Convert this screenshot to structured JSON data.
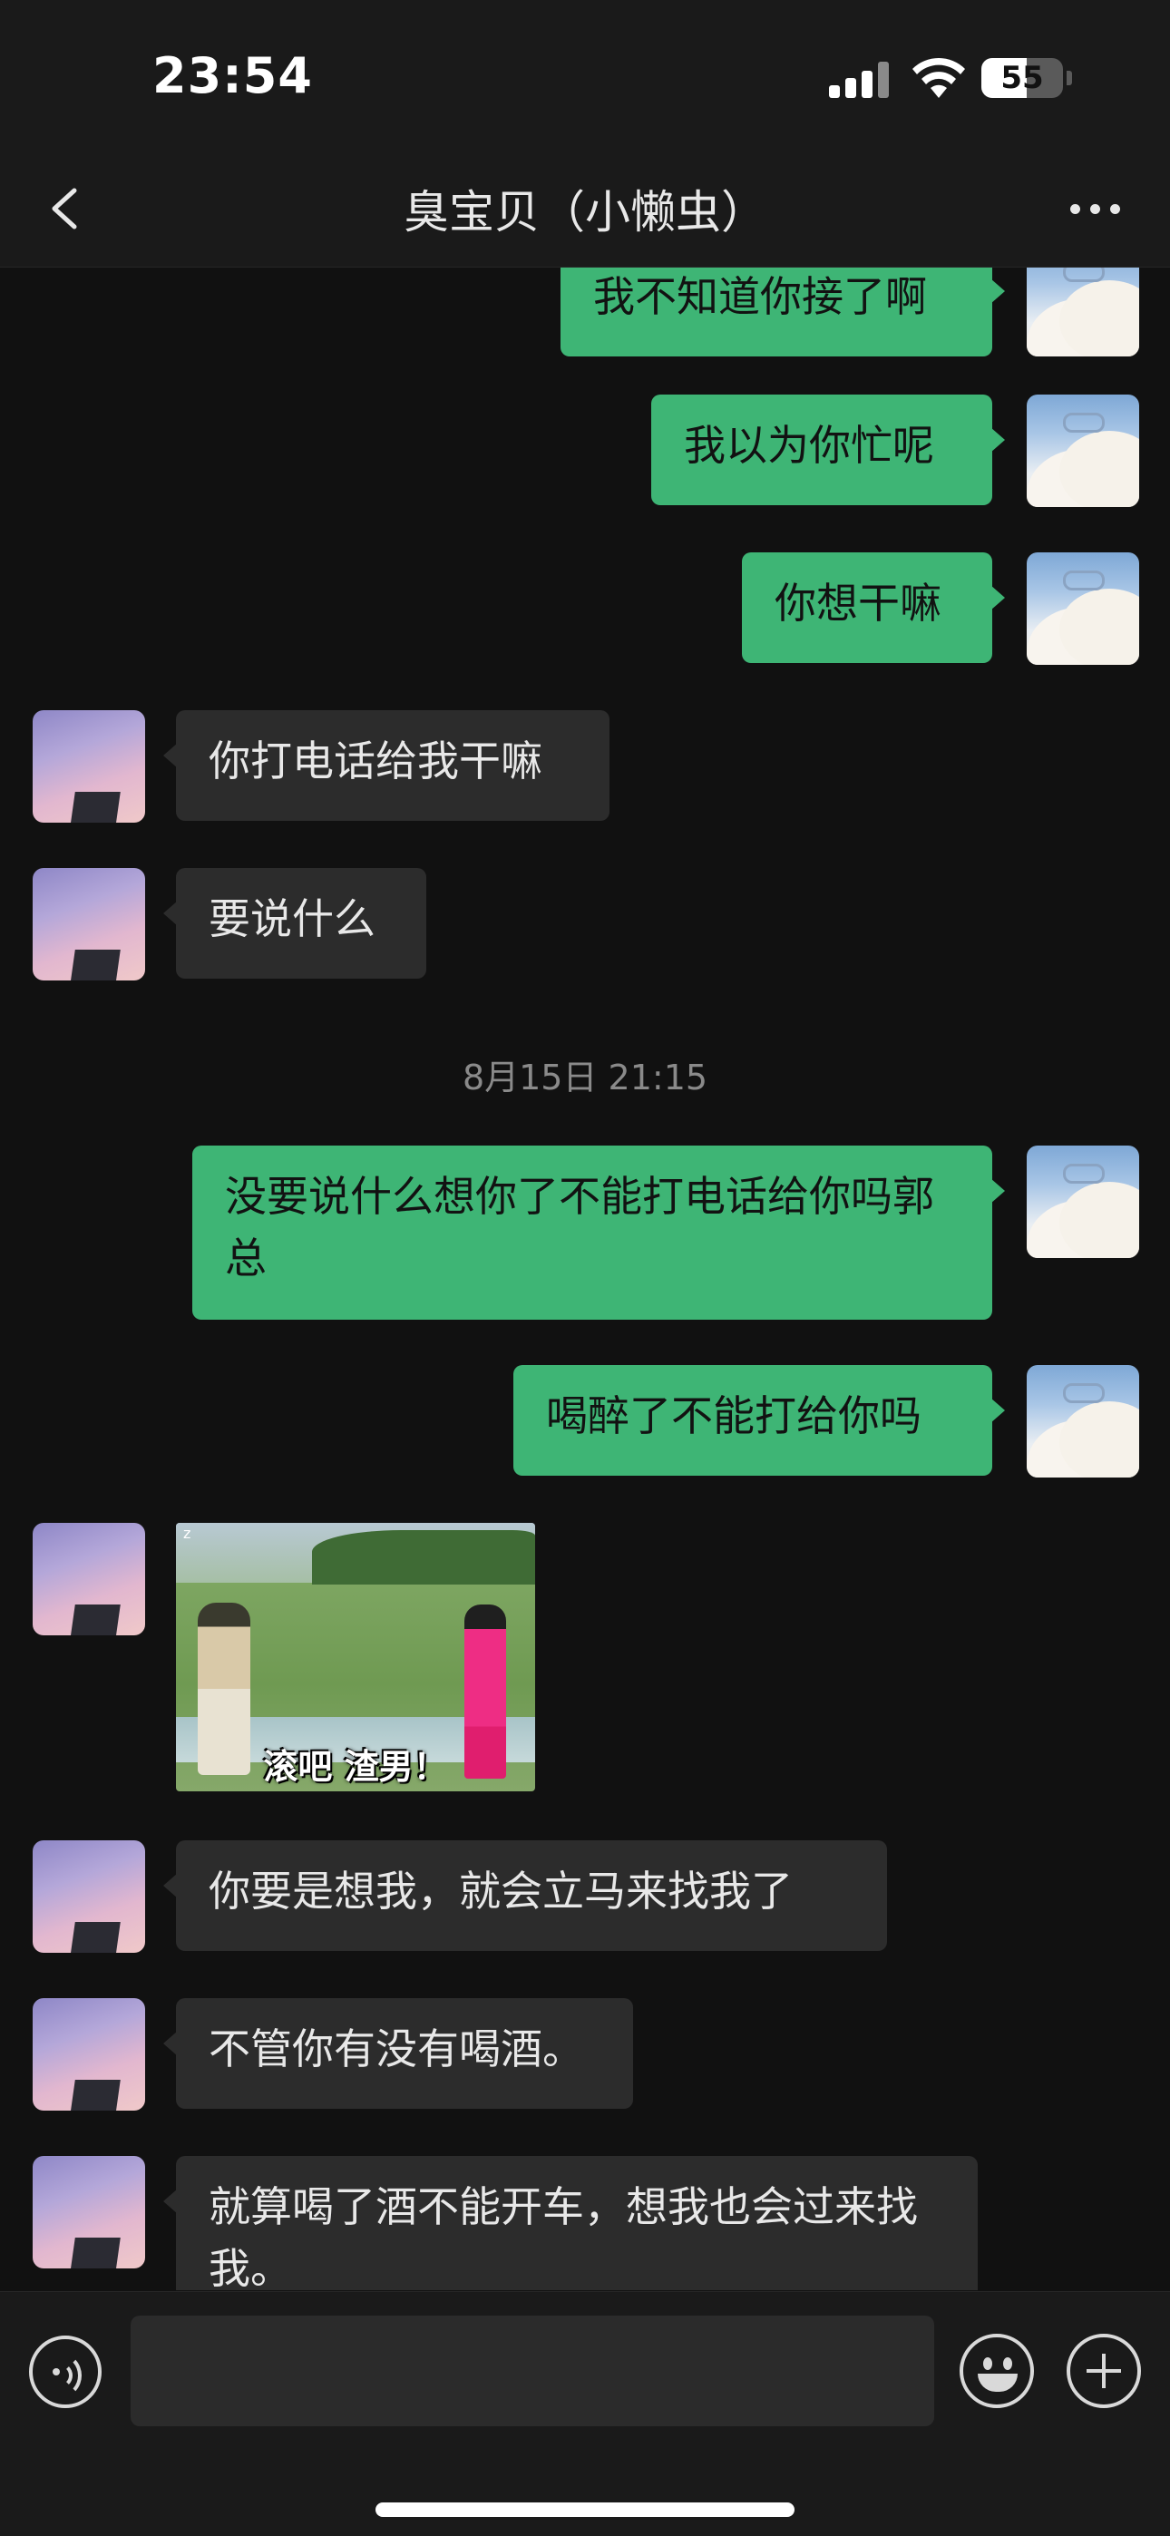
{
  "status_bar": {
    "time": "23:54",
    "battery": "55",
    "battery_level_percent": 55
  },
  "nav": {
    "title": "臭宝贝（小懒虫）",
    "back_icon": "chevron-left-icon",
    "more_icon": "more-dots-icon"
  },
  "messages": [
    {
      "side": "out",
      "text": "我不知道你接了啊"
    },
    {
      "side": "out",
      "text": "我以为你忙呢"
    },
    {
      "side": "out",
      "text": "你想干嘛"
    },
    {
      "side": "in",
      "text": "你打电话给我干嘛"
    },
    {
      "side": "in",
      "text": "要说什么"
    },
    {
      "side": "out",
      "text": "没要说什么想你了不能打电话给你吗郭总"
    },
    {
      "side": "out",
      "text": "喝醉了不能打给你吗"
    },
    {
      "side": "in",
      "type": "sticker",
      "caption": "滚吧 渣男！"
    },
    {
      "side": "in",
      "text": "你要是想我，就会立马来找我了"
    },
    {
      "side": "in",
      "text": "不管你有没有喝酒。"
    },
    {
      "side": "in",
      "text": "就算喝了酒不能开车，想我也会过来找我。"
    }
  ],
  "timestamp": "8月15日 21:15",
  "input_bar": {
    "voice_icon": "voice-icon",
    "emoji_icon": "emoji-icon",
    "plus_icon": "plus-icon",
    "input_value": ""
  },
  "colors": {
    "outgoing_bubble": "#3eb575",
    "incoming_bubble": "#2c2c2c",
    "background": "#111111"
  }
}
